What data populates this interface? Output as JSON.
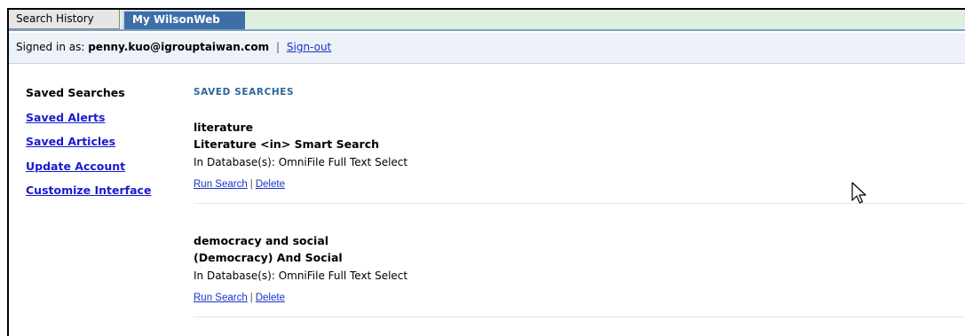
{
  "tabs": {
    "history_label": "Search History",
    "my_label": "My WilsonWeb"
  },
  "signin": {
    "prefix": "Signed in as:",
    "email": "penny.kuo@igrouptaiwan.com",
    "separator": "|",
    "signout_label": "Sign-out"
  },
  "sidebar": {
    "items": [
      {
        "label": "Saved Searches",
        "current": true
      },
      {
        "label": "Saved Alerts"
      },
      {
        "label": "Saved Articles"
      },
      {
        "label": "Update Account"
      },
      {
        "label": "Customize Interface"
      }
    ]
  },
  "main": {
    "heading": "SAVED SEARCHES",
    "entries": [
      {
        "name": "literature",
        "query": "Literature <in> Smart Search",
        "db": "In Database(s): OmniFile Full Text Select",
        "run_label": "Run Search",
        "sep": "|",
        "delete_label": "Delete"
      },
      {
        "name": "democracy and social",
        "query": "(Democracy) And Social",
        "db": "In Database(s): OmniFile Full Text Select",
        "run_label": "Run Search",
        "sep": "|",
        "delete_label": "Delete"
      }
    ]
  },
  "colors": {
    "tab_active_bg": "#3c6ea8",
    "tabbar_bg": "#ddf0dd",
    "heading": "#2e6597",
    "link": "#1a1ad0"
  },
  "icons": {
    "cursor": "mouse-pointer-icon"
  }
}
